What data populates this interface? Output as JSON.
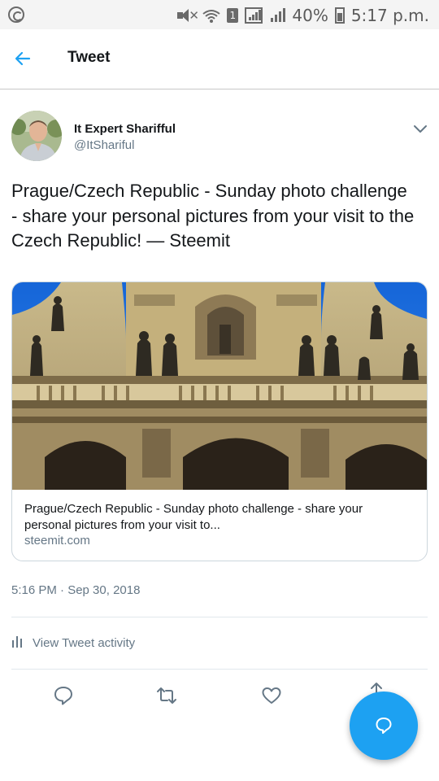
{
  "status_bar": {
    "battery": "40%",
    "time": "5:17 p.m.",
    "sim_slot": "1",
    "icons": [
      "sync-icon",
      "mute-icon",
      "wifi-icon",
      "sim-icon",
      "signal-icon",
      "signal-icon",
      "battery-icon"
    ]
  },
  "header": {
    "title": "Tweet",
    "back_icon": "back-arrow-icon"
  },
  "tweet": {
    "author_name": "It Expert Sharifful",
    "author_handle": "@ItShariful",
    "text": "Prague/Czech Republic - Sunday photo challenge - share your personal pictures from your visit to the Czech Republic! — Steemit",
    "timestamp": "5:16 PM · Sep 30, 2018"
  },
  "card": {
    "title": "Prague/Czech Republic - Sunday photo challenge - share your personal pictures from your visit to...",
    "domain": "steemit.com"
  },
  "activity": {
    "label": "View Tweet activity"
  },
  "actions": [
    "reply-icon",
    "retweet-icon",
    "like-icon",
    "share-icon"
  ],
  "fab_icon": "compose-reply-icon",
  "colors": {
    "accent": "#1da1f2",
    "secondary_text": "#657786",
    "primary_text": "#14171a"
  }
}
